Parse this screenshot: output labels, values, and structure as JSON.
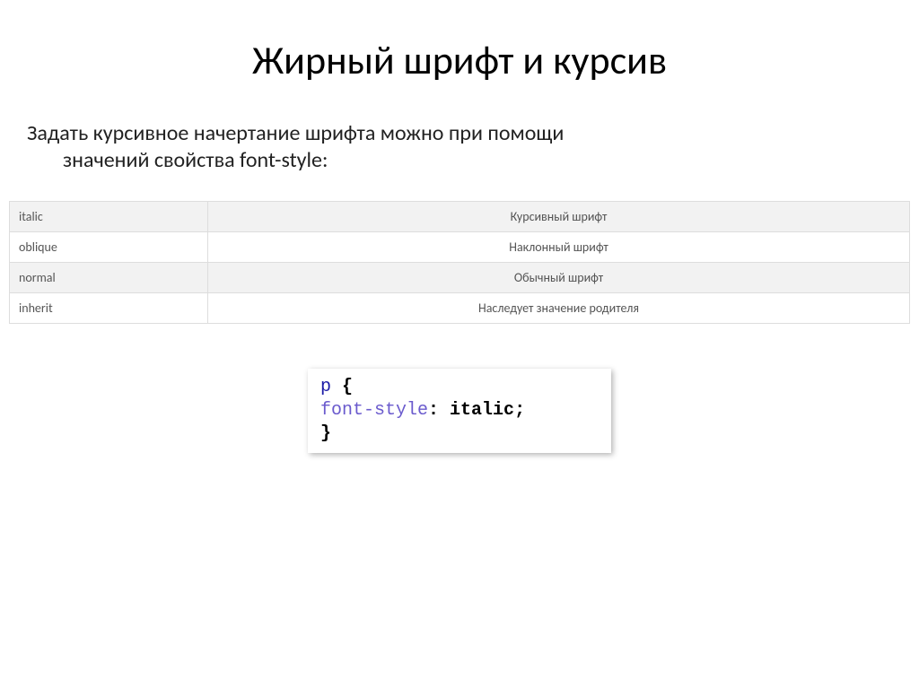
{
  "title": "Жирный шрифт и курсив",
  "intro_line1": "Задать курсивное начертание шрифта можно при помощи",
  "intro_line2": "значений свойства font-style:",
  "rows": [
    {
      "key": "italic",
      "desc": "Курсивный шрифт"
    },
    {
      "key": "oblique",
      "desc": "Наклонный шрифт"
    },
    {
      "key": "normal",
      "desc": "Обычный шрифт"
    },
    {
      "key": "inherit",
      "desc": "Наследует значение родителя"
    }
  ],
  "code": {
    "selector": "p",
    "property": "font-style",
    "value": "italic"
  }
}
